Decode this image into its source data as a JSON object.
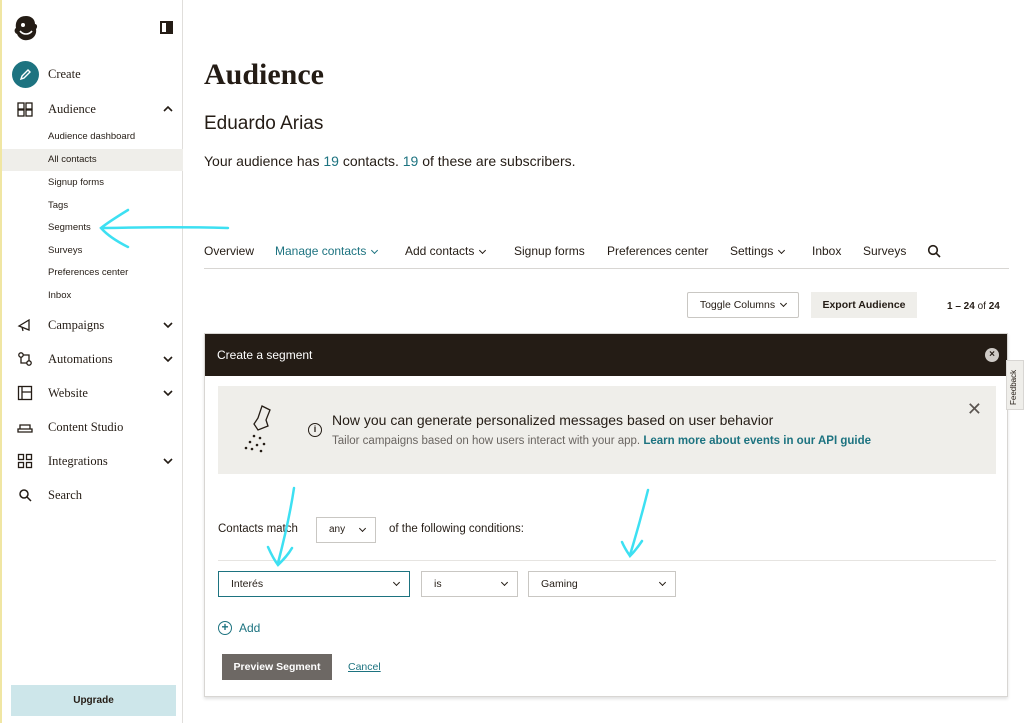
{
  "sidebar": {
    "create_label": "Create",
    "audience_label": "Audience",
    "audience_items": [
      {
        "label": "Audience dashboard"
      },
      {
        "label": "All contacts",
        "active": true
      },
      {
        "label": "Signup forms"
      },
      {
        "label": "Tags"
      },
      {
        "label": "Segments"
      },
      {
        "label": "Surveys"
      },
      {
        "label": "Preferences center"
      },
      {
        "label": "Inbox"
      }
    ],
    "campaigns_label": "Campaigns",
    "automations_label": "Automations",
    "website_label": "Website",
    "content_studio_label": "Content Studio",
    "integrations_label": "Integrations",
    "search_label": "Search",
    "upgrade_label": "Upgrade"
  },
  "header": {
    "title": "Audience",
    "audience_name": "Eduardo Arias",
    "summary_prefix": "Your audience has ",
    "contacts_count": "19",
    "summary_mid": " contacts. ",
    "subscribers_count": "19",
    "summary_suffix": " of these are subscribers."
  },
  "tabs": [
    {
      "label": "Overview"
    },
    {
      "label": "Manage contacts",
      "active": true
    },
    {
      "label": "Add contacts"
    },
    {
      "label": "Signup forms"
    },
    {
      "label": "Preferences center"
    },
    {
      "label": "Settings"
    },
    {
      "label": "Inbox"
    },
    {
      "label": "Surveys"
    }
  ],
  "toolbar": {
    "toggle_columns": "Toggle Columns",
    "export_audience": "Export Audience",
    "pager_range": "1 – 24",
    "pager_of": " of ",
    "pager_total": "24"
  },
  "segment": {
    "header_title": "Create a segment",
    "banner_title": "Now you can generate personalized messages based on user behavior",
    "banner_text": "Tailor campaigns based on how users interact with your app. ",
    "banner_link": "Learn more about events in our API guide",
    "match_label": "Contacts match",
    "match_value": "any",
    "match_after": "of the following conditions:",
    "condition_field": "Interés",
    "condition_operator": "is",
    "condition_value": "Gaming",
    "add_label": "Add",
    "preview_button": "Preview Segment",
    "cancel_link": "Cancel"
  },
  "feedback_label": "Feedback",
  "colors": {
    "accent": "#1d7380",
    "dark": "#241c15",
    "annotation": "#3de0f2"
  }
}
